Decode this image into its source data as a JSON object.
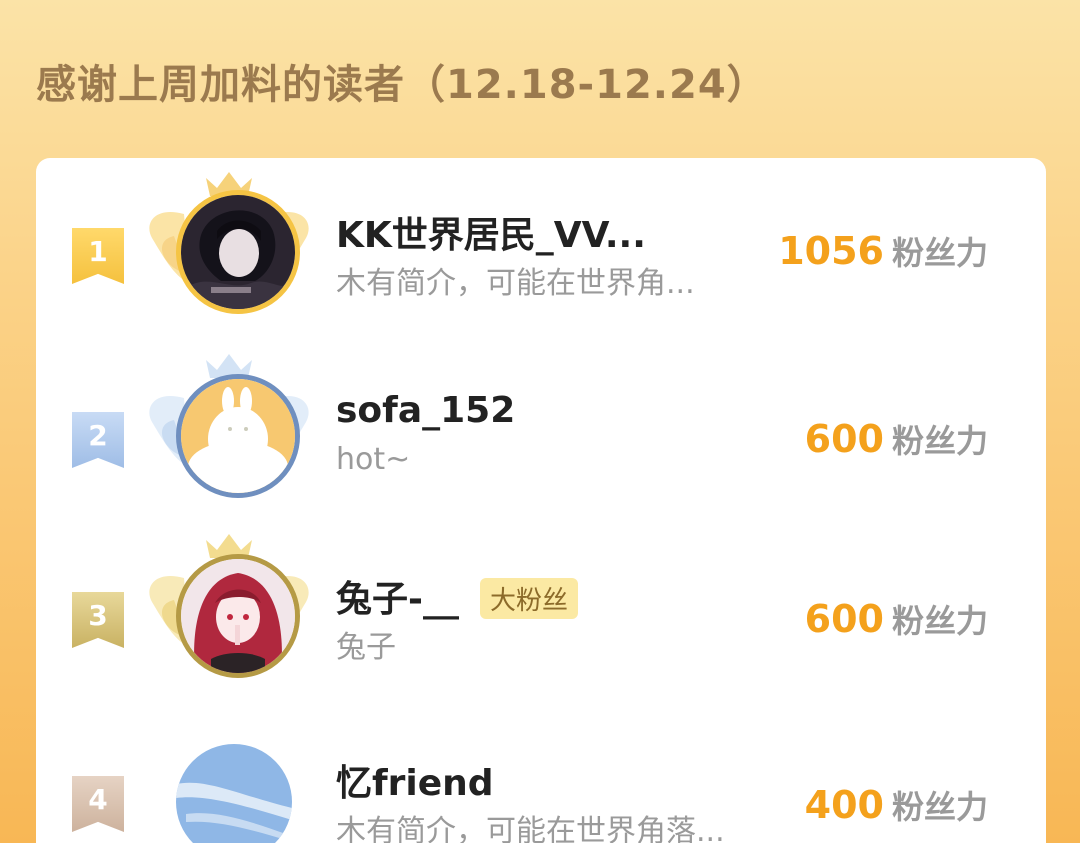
{
  "page": {
    "title": "感谢上周加料的读者（12.18-12.24）"
  },
  "readers": [
    {
      "rank": "1",
      "name": "KK世界居民_VV...",
      "bio": "木有简介，可能在世界角...",
      "score": "1056",
      "unit": "粉丝力",
      "badge": ""
    },
    {
      "rank": "2",
      "name": "sofa_152",
      "bio": "hot~",
      "score": "600",
      "unit": "粉丝力",
      "badge": ""
    },
    {
      "rank": "3",
      "name": "兔子-__",
      "bio": "兔子",
      "score": "600",
      "unit": "粉丝力",
      "badge": "大粉丝"
    },
    {
      "rank": "4",
      "name": "忆friend",
      "bio": "木有简介，可能在世界角落...",
      "score": "400",
      "unit": "粉丝力",
      "badge": ""
    }
  ],
  "colors": {
    "score": "#f4a11c",
    "title": "#9b7a4e",
    "rank1": "#f5c13e",
    "rank2": "#9fbde6",
    "rank3": "#c9b263",
    "rank4": "#cdb29d"
  }
}
